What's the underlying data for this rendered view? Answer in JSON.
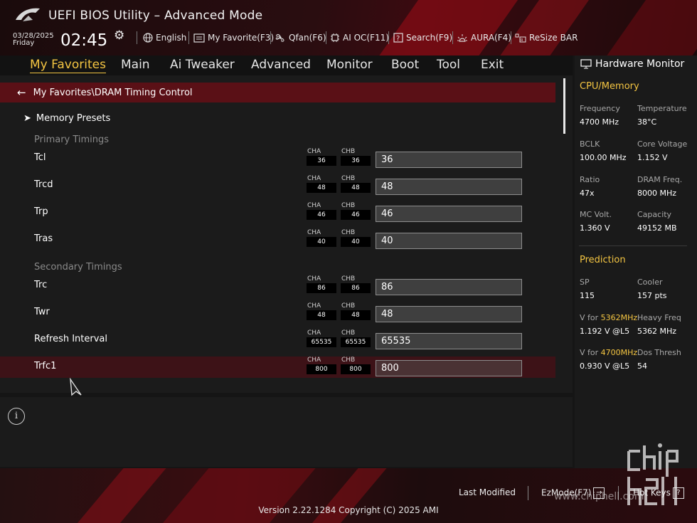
{
  "header": {
    "title": "UEFI BIOS Utility – Advanced Mode",
    "date": "03/28/2025",
    "day": "Friday",
    "time": "02:45",
    "items": [
      "English",
      "My Favorite(F3)",
      "Qfan(F6)",
      "AI OC(F11)",
      "Search(F9)",
      "AURA(F4)",
      "ReSize BAR"
    ]
  },
  "tabs": [
    "My Favorites",
    "Main",
    "Ai Tweaker",
    "Advanced",
    "Monitor",
    "Boot",
    "Tool",
    "Exit"
  ],
  "breadcrumb": "My Favorites\\DRAM Timing Control",
  "presets_label": "Memory Presets",
  "sections": {
    "primary": "Primary Timings",
    "secondary": "Secondary Timings"
  },
  "channel_labels": {
    "a": "CHA",
    "b": "CHB"
  },
  "rows": [
    {
      "label": "Tcl",
      "cha": "36",
      "chb": "36",
      "value": "36"
    },
    {
      "label": "Trcd",
      "cha": "48",
      "chb": "48",
      "value": "48"
    },
    {
      "label": "Trp",
      "cha": "46",
      "chb": "46",
      "value": "46"
    },
    {
      "label": "Tras",
      "cha": "40",
      "chb": "40",
      "value": "40"
    },
    {
      "label": "Trc",
      "cha": "86",
      "chb": "86",
      "value": "86"
    },
    {
      "label": "Twr",
      "cha": "48",
      "chb": "48",
      "value": "48"
    },
    {
      "label": "Refresh Interval",
      "cha": "65535",
      "chb": "65535",
      "value": "65535"
    },
    {
      "label": "Trfc1",
      "cha": "800",
      "chb": "800",
      "value": "800"
    }
  ],
  "hw": {
    "title": "Hardware Monitor",
    "cpu_section": "CPU/Memory",
    "frequency_label": "Frequency",
    "frequency": "4700 MHz",
    "temperature_label": "Temperature",
    "temperature": "38°C",
    "bclk_label": "BCLK",
    "bclk": "100.00 MHz",
    "core_voltage_label": "Core Voltage",
    "core_voltage": "1.152 V",
    "ratio_label": "Ratio",
    "ratio": "47x",
    "dram_freq_label": "DRAM Freq.",
    "dram_freq": "8000 MHz",
    "mc_volt_label": "MC Volt.",
    "mc_volt": "1.360 V",
    "capacity_label": "Capacity",
    "capacity": "49152 MB",
    "prediction_section": "Prediction",
    "sp_label": "SP",
    "sp": "115",
    "cooler_label": "Cooler",
    "cooler": "157 pts",
    "v_for_label": "V for",
    "v_for_1_freq": "5362MHz",
    "v_for_1": "1.192 V @L5",
    "heavy_freq_label": "Heavy Freq",
    "heavy_freq": "5362 MHz",
    "v_for_2_freq": "4700MHz",
    "v_for_2": "0.930 V @L5",
    "dos_thresh_label": "Dos Thresh",
    "dos_thresh": "54"
  },
  "footer": {
    "last_modified": "Last Modified",
    "ezmode": "EzMode(F7)",
    "hotkeys": "Hot Keys",
    "hotkeys_key": "?",
    "version": "Version 2.22.1284 Copyright (C) 2025 AMI"
  },
  "watermark": {
    "url": "www.chiphell.com"
  },
  "colors": {
    "accent": "#f4c542",
    "crumb_bg": "#5a1016",
    "selected_row": "#3d1217"
  }
}
